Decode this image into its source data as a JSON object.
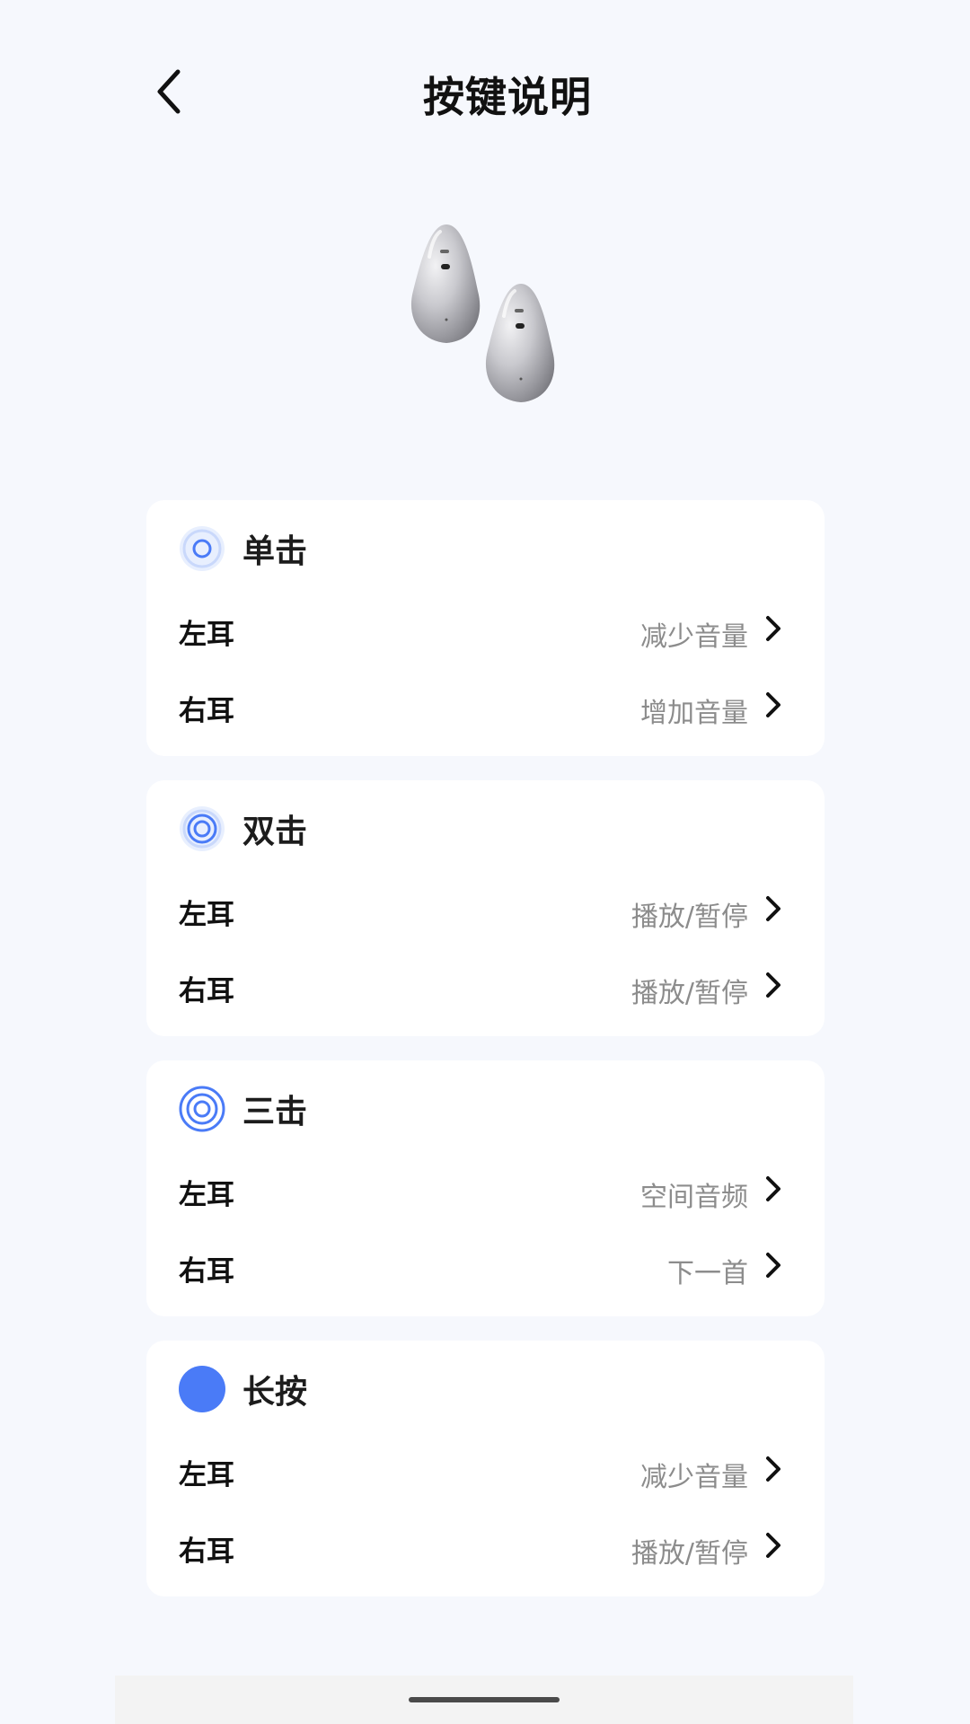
{
  "header": {
    "title": "按键说明",
    "back_icon": "chevron-left-icon"
  },
  "product": {
    "image": "earbuds-image"
  },
  "sections": [
    {
      "id": "single",
      "title": "单击",
      "icon": "single-tap-icon",
      "rows": [
        {
          "label": "左耳",
          "value": "减少音量"
        },
        {
          "label": "右耳",
          "value": "增加音量"
        }
      ]
    },
    {
      "id": "double",
      "title": "双击",
      "icon": "double-tap-icon",
      "rows": [
        {
          "label": "左耳",
          "value": "播放/暂停"
        },
        {
          "label": "右耳",
          "value": "播放/暂停"
        }
      ]
    },
    {
      "id": "triple",
      "title": "三击",
      "icon": "triple-tap-icon",
      "rows": [
        {
          "label": "左耳",
          "value": "空间音频"
        },
        {
          "label": "右耳",
          "value": "下一首"
        }
      ]
    },
    {
      "id": "long",
      "title": "长按",
      "icon": "long-press-icon",
      "rows": [
        {
          "label": "左耳",
          "value": "减少音量"
        },
        {
          "label": "右耳",
          "value": "播放/暂停"
        }
      ]
    }
  ],
  "colors": {
    "accent": "#4a7bf7",
    "accent_light": "#c9d8fb",
    "background": "#f6f8fd",
    "card": "#ffffff",
    "value_text": "#8c8c8c"
  }
}
